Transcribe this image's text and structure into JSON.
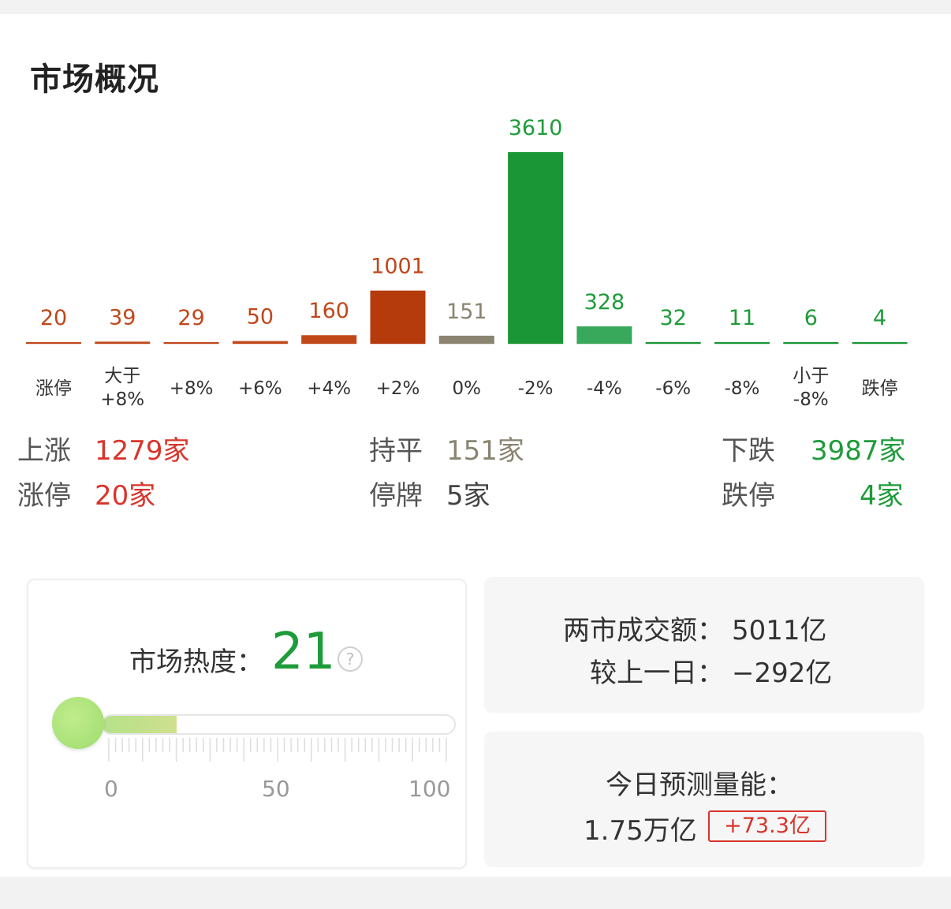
{
  "title": "市场概况",
  "chart_data": {
    "type": "bar",
    "categories": [
      "涨停",
      "大于\n+8%",
      "+8%",
      "+6%",
      "+4%",
      "+2%",
      "0%",
      "-2%",
      "-4%",
      "-6%",
      "-8%",
      "小于\n-8%",
      "跌停"
    ],
    "values": [
      20,
      39,
      29,
      50,
      160,
      1001,
      151,
      3610,
      328,
      32,
      11,
      6,
      4
    ],
    "colors": [
      "#c0471a",
      "#c0471a",
      "#c0471a",
      "#c0471a",
      "#c0471a",
      "#b53a0c",
      "#8a8471",
      "#1a9636",
      "#38a85a",
      "#1a9636",
      "#1a9636",
      "#1a9636",
      "#1a9636"
    ],
    "label_colors": [
      "#c0471a",
      "#c0471a",
      "#c0471a",
      "#c0471a",
      "#c0471a",
      "#c0471a",
      "#8a8471",
      "#1e9b3a",
      "#1e9b3a",
      "#1e9b3a",
      "#1e9b3a",
      "#1e9b3a",
      "#1e9b3a"
    ],
    "ylim": [
      0,
      3610
    ]
  },
  "stats": {
    "up_label": "上涨",
    "up_value": "1279家",
    "flat_label": "持平",
    "flat_value": "151家",
    "down_label": "下跌",
    "down_value": "3987家",
    "limit_up_label": "涨停",
    "limit_up_value": "20家",
    "halt_label": "停牌",
    "halt_value": "5家",
    "limit_down_label": "跌停",
    "limit_down_value": "4家"
  },
  "heat": {
    "label": "市场热度：",
    "value": "21",
    "level": 21,
    "help_icon": "question-circle-icon",
    "scale": [
      "0",
      "50",
      "100"
    ]
  },
  "volume": {
    "label": "两市成交额：",
    "value": "5011亿",
    "compare_label": "较上一日：",
    "compare_value": "−292亿"
  },
  "prediction": {
    "label": "今日预测量能：",
    "value": "1.75万亿",
    "delta": "+73.3亿"
  },
  "colors": {
    "red": "#d9342b",
    "green": "#1e9b3a",
    "gray": "#8a8471"
  }
}
